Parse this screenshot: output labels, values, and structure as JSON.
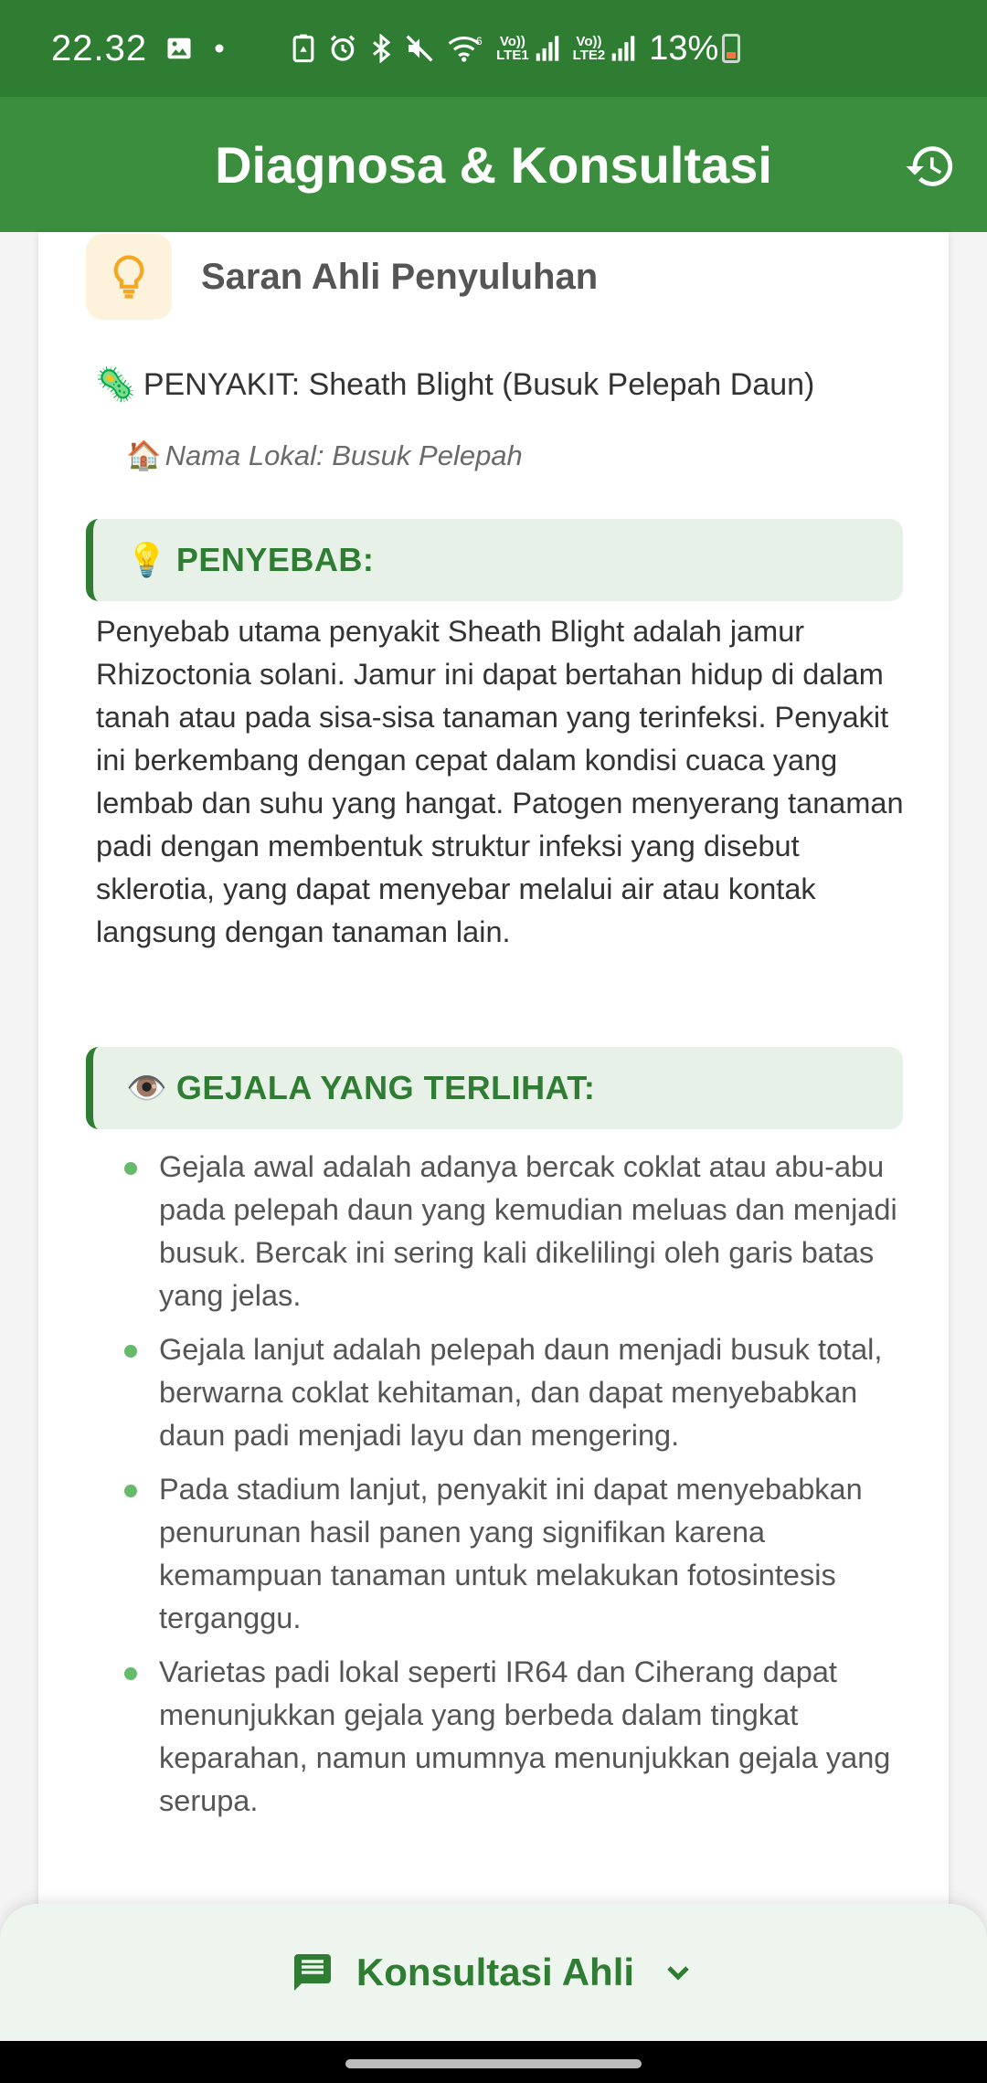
{
  "status_bar": {
    "time": "22.32",
    "battery": "13%",
    "sim1_label": "LTE1",
    "sim2_label": "LTE2",
    "icons": [
      "gallery-icon",
      "dot-icon",
      "recycle-icon",
      "alarm-icon",
      "bluetooth-icon",
      "mute-icon",
      "wifi-icon",
      "signal-icon",
      "signal-icon",
      "battery-icon"
    ]
  },
  "app_bar": {
    "title": "Diagnosa & Konsultasi",
    "history_icon": "history-icon"
  },
  "card": {
    "title": "Saran Ahli Penyuluhan",
    "disease_emoji": "🦠",
    "disease": "PENYAKIT: Sheath Blight (Busuk Pelepah Daun)",
    "local_emoji": "🏠",
    "local_name": "Nama Lokal: Busuk Pelepah",
    "cause": {
      "emoji": "💡",
      "heading": "PENYEBAB:",
      "text": "Penyebab utama penyakit Sheath Blight adalah jamur Rhizoctonia solani. Jamur ini dapat bertahan hidup di dalam tanah atau pada sisa-sisa tanaman yang terinfeksi. Penyakit ini berkembang dengan cepat dalam kondisi cuaca yang lembab dan suhu yang hangat. Patogen menyerang tanaman padi dengan membentuk struktur infeksi yang disebut sklerotia, yang dapat menyebar melalui air atau kontak langsung dengan tanaman lain."
    },
    "symptoms": {
      "emoji": "👁️",
      "heading": "GEJALA YANG TERLIHAT:",
      "items": [
        "Gejala awal adalah adanya bercak coklat atau abu-abu pada pelepah daun yang kemudian meluas dan menjadi busuk. Bercak ini sering kali dikelilingi oleh garis batas yang jelas.",
        "Gejala lanjut adalah pelepah daun menjadi busuk total, berwarna coklat kehitaman, dan dapat menyebabkan daun padi menjadi layu dan mengering.",
        "Pada stadium lanjut, penyakit ini dapat menyebabkan penurunan hasil panen yang signifikan karena kemampuan tanaman untuk melakukan fotosintesis terganggu.",
        "Varietas padi lokal seperti IR64 dan Ciherang dapat menunjukkan gejala yang berbeda dalam tingkat keparahan, namun umumnya menunjukkan gejala yang serupa."
      ]
    }
  },
  "bottom_sheet": {
    "button_label": "Konsultasi Ahli",
    "chat_icon": "chat-icon",
    "chevron_icon": "chevron-down-icon"
  },
  "colors": {
    "status_bar": "#2e7d32",
    "app_bar": "#3a8e3d",
    "accent": "#2e7d32",
    "section_bg": "#e8f1e8",
    "bullet": "#66bb6a",
    "bulb_bg": "#fdf3dc",
    "bulb": "#f5a623"
  }
}
